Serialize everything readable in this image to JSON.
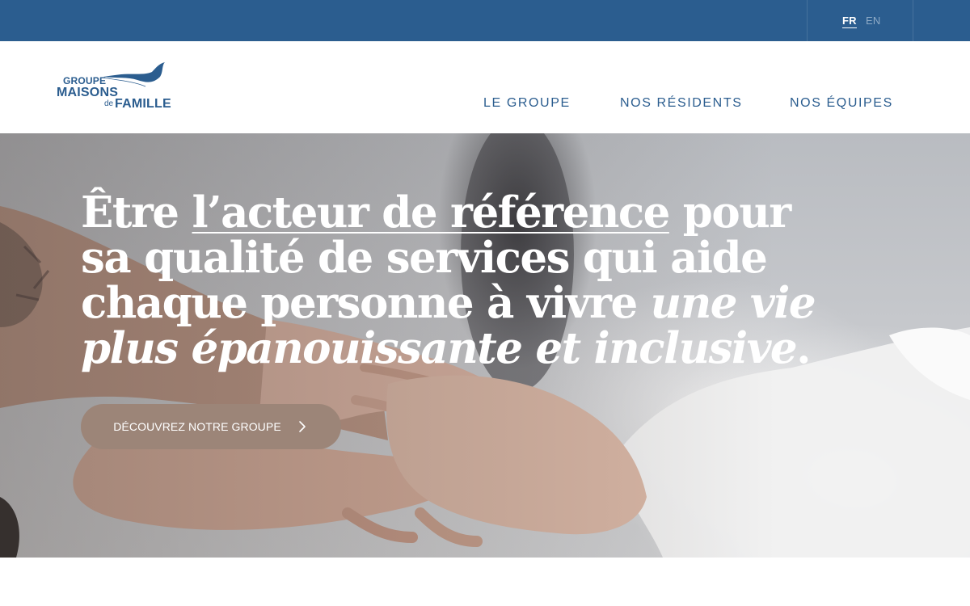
{
  "topbar": {
    "languages": [
      {
        "code": "FR",
        "active": true
      },
      {
        "code": "EN",
        "active": false
      }
    ]
  },
  "logo": {
    "line1": "GROUPE",
    "line2": "MAISONS",
    "line3": "de",
    "line4": "FAMILLE",
    "icon": "bird-icon"
  },
  "nav": {
    "items": [
      {
        "label": "LE GROUPE"
      },
      {
        "label": "NOS RÉSIDENTS"
      },
      {
        "label": "NOS ÉQUIPES"
      }
    ]
  },
  "hero": {
    "title_part1": "Être ",
    "title_underlined": "l’acteur de référence",
    "title_part2": " pour sa qualité de services qui aide chaque personne à vivre ",
    "title_italic": "une vie plus épanouissante et inclusive",
    "title_end": ".",
    "cta_label": "DÉCOUVREZ NOTRE GROUPE",
    "cta_icon": "chevron-right-icon",
    "image": "hands-holding-photo"
  },
  "colors": {
    "brand_blue": "#2b5d8f",
    "cta_brown": "#9c8578",
    "white": "#ffffff"
  }
}
